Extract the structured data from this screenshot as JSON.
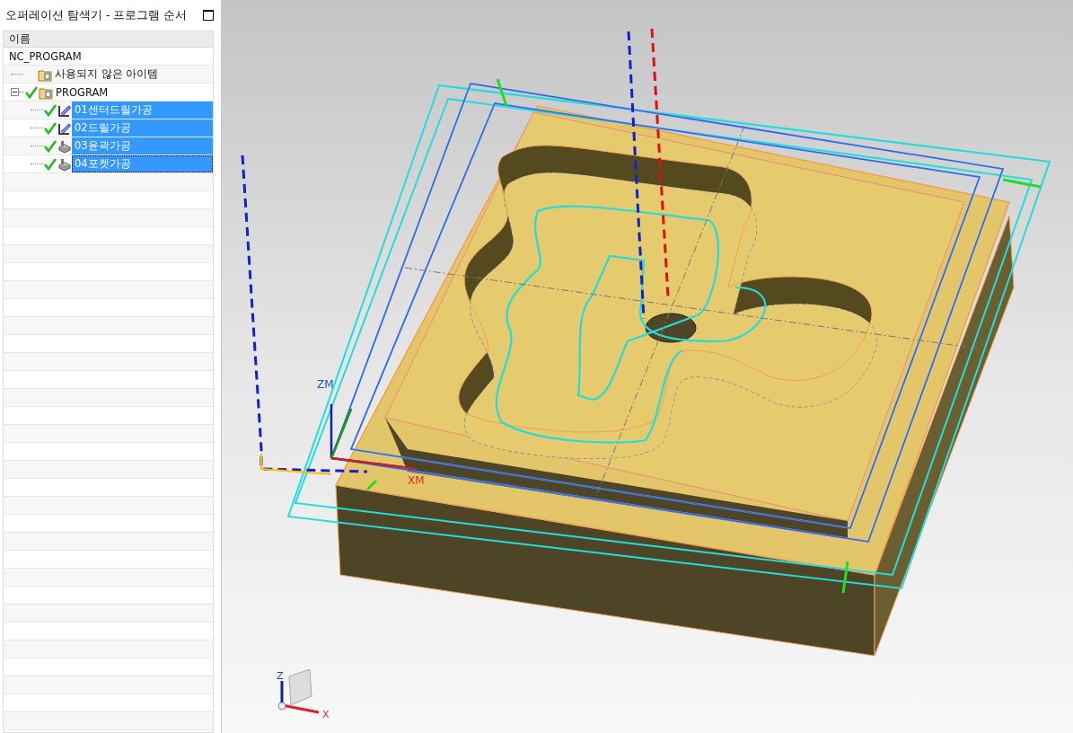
{
  "panel": {
    "title": "오퍼레이션 탐색기 - 프로그램 순서",
    "column": "이름"
  },
  "tree": [
    {
      "label": "NC_PROGRAM",
      "selected": false,
      "children": [
        {
          "label": "사용되지 않은 아이템",
          "kind": "folder",
          "selected": false
        },
        {
          "label": "PROGRAM",
          "kind": "folder",
          "checked": true,
          "selected": false,
          "expanded": true,
          "children": [
            {
              "label": "01센터드릴가공",
              "kind": "drill",
              "checked": true,
              "selected": true
            },
            {
              "label": "02드릴가공",
              "kind": "drill",
              "checked": true,
              "selected": true
            },
            {
              "label": "03윤곽가공",
              "kind": "mill",
              "checked": true,
              "selected": true
            },
            {
              "label": "04포켓가공",
              "kind": "mill",
              "checked": true,
              "selected": true
            }
          ]
        }
      ]
    }
  ],
  "viewport": {
    "work_axes": {
      "z": "ZM",
      "x": "XM"
    },
    "triad": {
      "z": "Z",
      "x": "X"
    }
  }
}
